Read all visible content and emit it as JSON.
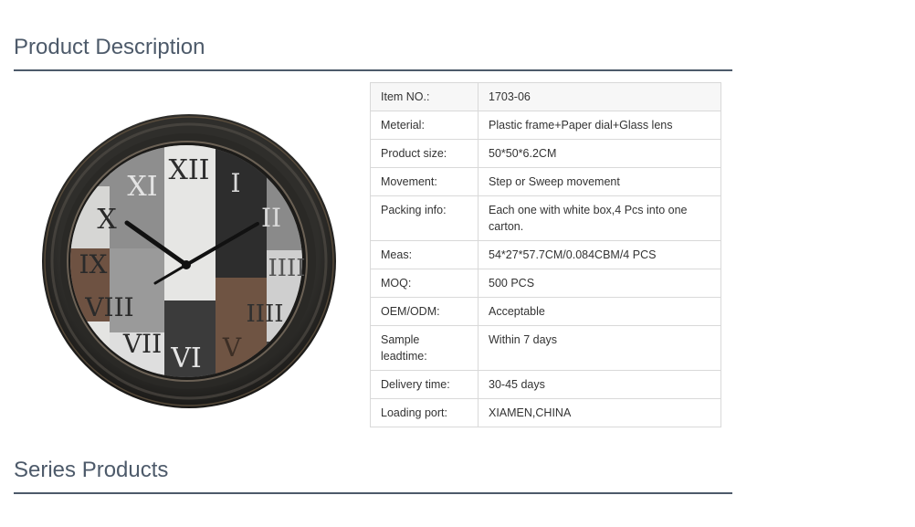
{
  "sections": {
    "product_description": "Product Description",
    "series_products": "Series Products"
  },
  "product_image": {
    "alt": "Wall clock with roman numerals",
    "numerals": [
      "XII",
      "I",
      "II",
      "III",
      "IIII",
      "V",
      "VI",
      "VII",
      "VIII",
      "IX",
      "X",
      "XI"
    ]
  },
  "specs": [
    {
      "label": "Item NO.:",
      "value": "1703-06"
    },
    {
      "label": "Meterial:",
      "value": "Plastic frame+Paper dial+Glass lens"
    },
    {
      "label": "Product size:",
      "value": "50*50*6.2CM"
    },
    {
      "label": "Movement:",
      "value": "Step or Sweep movement"
    },
    {
      "label": "Packing info:",
      "value": "Each one with white box,4 Pcs into one carton."
    },
    {
      "label": "Meas:",
      "value": "54*27*57.7CM/0.084CBM/4 PCS"
    },
    {
      "label": "MOQ:",
      "value": "500 PCS"
    },
    {
      "label": "OEM/ODM:",
      "value": "Acceptable"
    },
    {
      "label": "Sample leadtime:",
      "value": "Within 7 days"
    },
    {
      "label": "Delivery time:",
      "value": "30-45 days"
    },
    {
      "label": "Loading port:",
      "value": "XIAMEN,CHINA"
    }
  ]
}
